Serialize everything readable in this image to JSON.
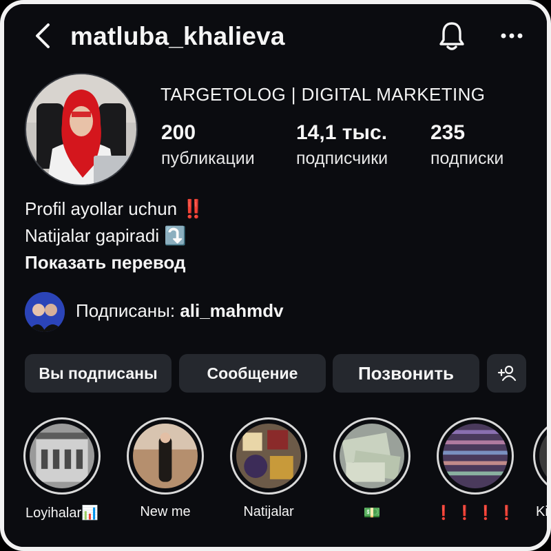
{
  "header": {
    "username": "matluba_khalieva"
  },
  "profile": {
    "category_title": "TARGETOLOG | DIGITAL MARKETING",
    "stats": [
      {
        "value": "200",
        "label": "публикации"
      },
      {
        "value": "14,1 тыс.",
        "label": "подписчики"
      },
      {
        "value": "235",
        "label": "подписки"
      }
    ],
    "bio": {
      "line1": "Profil ayollar uchun",
      "line1_emoji": "‼️",
      "line2": "Natijalar gapiradi",
      "line2_emoji": "⤵️",
      "translate_label": "Показать перевод"
    },
    "followed_by": {
      "prefix": "Подписаны: ",
      "username": "ali_mahmdv"
    }
  },
  "actions": {
    "following_label": "Вы подписаны",
    "message_label": "Сообщение",
    "call_label": "Позвонить"
  },
  "highlights": [
    {
      "caption": "Loyihalar📊"
    },
    {
      "caption": "New me"
    },
    {
      "caption": "Natijalar"
    },
    {
      "caption": "💵"
    },
    {
      "caption": "❗ ❗ ❗ ❗"
    },
    {
      "caption": "Ki"
    }
  ],
  "colors": {
    "background": "#0b0c10",
    "button_bg": "#25282e",
    "text": "#f5f5f5",
    "accent_red": "#e22a2a",
    "highlight_ring": "#d9d9d9"
  },
  "icons": [
    "back-arrow-icon",
    "bell-icon",
    "more-icon",
    "add-person-icon"
  ]
}
